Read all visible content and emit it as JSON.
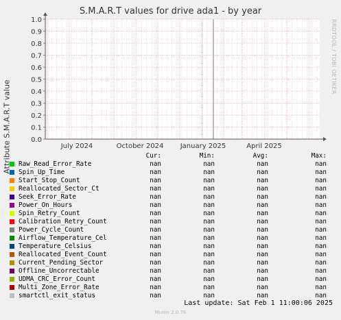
{
  "title": "S.M.A.R.T values for drive ada1 - by year",
  "watermark": "RRDTOOL / TOBI OETIKER",
  "chart_data": {
    "type": "line",
    "title": "S.M.A.R.T values for drive ada1 - by year",
    "ylabel": "Attribute S.M.A.R.T value",
    "xlabel": "",
    "ylim": [
      0,
      1.0
    ],
    "y_ticks": [
      "0.0",
      "0.1",
      "0.2",
      "0.3",
      "0.4",
      "0.5",
      "0.6",
      "0.7",
      "0.8",
      "0.9",
      "1.0"
    ],
    "x_ticks": [
      "July 2024",
      "October 2024",
      "January 2025",
      "April 2025"
    ],
    "grid": true,
    "series": []
  },
  "legend_headers": {
    "cur": "Cur:",
    "min": "Min:",
    "avg": "Avg:",
    "max": "Max:"
  },
  "legend": [
    {
      "name": "Raw_Read_Error_Rate",
      "color": "#00cc00",
      "cur": "nan",
      "min": "nan",
      "avg": "nan",
      "max": "nan"
    },
    {
      "name": "Spin_Up_Time",
      "color": "#0066b3",
      "cur": "nan",
      "min": "nan",
      "avg": "nan",
      "max": "nan"
    },
    {
      "name": "Start_Stop_Count",
      "color": "#ff8000",
      "cur": "nan",
      "min": "nan",
      "avg": "nan",
      "max": "nan"
    },
    {
      "name": "Reallocated_Sector_Ct",
      "color": "#ffcc00",
      "cur": "nan",
      "min": "nan",
      "avg": "nan",
      "max": "nan"
    },
    {
      "name": "Seek_Error_Rate",
      "color": "#330099",
      "cur": "nan",
      "min": "nan",
      "avg": "nan",
      "max": "nan"
    },
    {
      "name": "Power_On_Hours",
      "color": "#990099",
      "cur": "nan",
      "min": "nan",
      "avg": "nan",
      "max": "nan"
    },
    {
      "name": "Spin_Retry_Count",
      "color": "#ccff00",
      "cur": "nan",
      "min": "nan",
      "avg": "nan",
      "max": "nan"
    },
    {
      "name": "Calibration_Retry_Count",
      "color": "#ff0000",
      "cur": "nan",
      "min": "nan",
      "avg": "nan",
      "max": "nan"
    },
    {
      "name": "Power_Cycle_Count",
      "color": "#808080",
      "cur": "nan",
      "min": "nan",
      "avg": "nan",
      "max": "nan"
    },
    {
      "name": "Airflow_Temperature_Cel",
      "color": "#008f00",
      "cur": "nan",
      "min": "nan",
      "avg": "nan",
      "max": "nan"
    },
    {
      "name": "Temperature_Celsius",
      "color": "#00487d",
      "cur": "nan",
      "min": "nan",
      "avg": "nan",
      "max": "nan"
    },
    {
      "name": "Reallocated_Event_Count",
      "color": "#b35a00",
      "cur": "nan",
      "min": "nan",
      "avg": "nan",
      "max": "nan"
    },
    {
      "name": "Current_Pending_Sector",
      "color": "#b38f00",
      "cur": "nan",
      "min": "nan",
      "avg": "nan",
      "max": "nan"
    },
    {
      "name": "Offline_Uncorrectable",
      "color": "#6b006b",
      "cur": "nan",
      "min": "nan",
      "avg": "nan",
      "max": "nan"
    },
    {
      "name": "UDMA_CRC_Error_Count",
      "color": "#8fb300",
      "cur": "nan",
      "min": "nan",
      "avg": "nan",
      "max": "nan"
    },
    {
      "name": "Multi_Zone_Error_Rate",
      "color": "#b30000",
      "cur": "nan",
      "min": "nan",
      "avg": "nan",
      "max": "nan"
    },
    {
      "name": "smartctl_exit_status",
      "color": "#bebebe",
      "cur": "nan",
      "min": "nan",
      "avg": "nan",
      "max": "nan"
    }
  ],
  "last_update": "Last update:  Sat Feb  1 11:00:06 2025",
  "version": "Munin 2.0.76"
}
